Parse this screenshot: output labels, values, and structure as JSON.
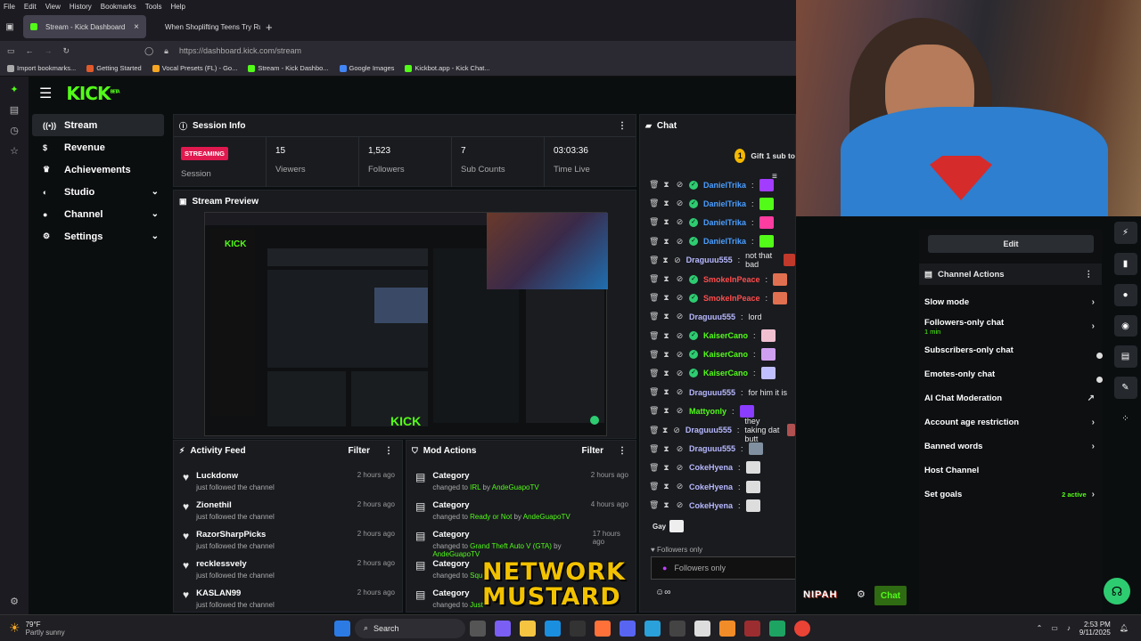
{
  "menu": [
    "File",
    "Edit",
    "View",
    "History",
    "Bookmarks",
    "Tools",
    "Help"
  ],
  "tabs": [
    {
      "label": "Stream - Kick Dashboard",
      "active": true
    },
    {
      "label": "When Shoplifting Teens Try Run",
      "active": false
    }
  ],
  "url": "https://dashboard.kick.com/stream",
  "bookmarks": [
    "Import bookmarks...",
    "Getting Started",
    "Vocal Presets (FL) - Go...",
    "Stream - Kick Dashbo...",
    "Google Images",
    "Kickbot.app - Kick Chat..."
  ],
  "app": {
    "logo": "KICK",
    "logo_sup": "BETA"
  },
  "nav": [
    {
      "label": "Stream",
      "icon": "stream-icon",
      "selected": true
    },
    {
      "label": "Revenue",
      "icon": "dollar-icon"
    },
    {
      "label": "Achievements",
      "icon": "trophy-icon"
    },
    {
      "label": "Studio",
      "icon": "studio-icon",
      "chevron": true
    },
    {
      "label": "Channel",
      "icon": "user-icon",
      "chevron": true
    },
    {
      "label": "Settings",
      "icon": "gear-icon",
      "chevron": true
    }
  ],
  "session": {
    "title": "Session Info",
    "status": "STREAMING",
    "status_label": "Session",
    "stats": [
      {
        "value": "15",
        "label": "Viewers"
      },
      {
        "value": "1,523",
        "label": "Followers"
      },
      {
        "value": "7",
        "label": "Sub Counts"
      },
      {
        "value": "03:03:36",
        "label": "Time Live"
      }
    ]
  },
  "preview": {
    "title": "Stream Preview"
  },
  "activity": {
    "title": "Activity Feed",
    "filter": "Filter",
    "items": [
      {
        "name": "Luckdonw",
        "sub": "just followed the channel",
        "time": "2 hours ago"
      },
      {
        "name": "Zionethil",
        "sub": "just followed the channel",
        "time": "2 hours ago"
      },
      {
        "name": "RazorSharpPicks",
        "sub": "just followed the channel",
        "time": "2 hours ago"
      },
      {
        "name": "recklessvely",
        "sub": "just followed the channel",
        "time": "2 hours ago"
      },
      {
        "name": "KASLAN99",
        "sub": "just followed the channel",
        "time": "2 hours ago"
      }
    ]
  },
  "mod": {
    "title": "Mod Actions",
    "filter": "Filter",
    "items": [
      {
        "name": "Category",
        "pre": "changed to ",
        "target": "IRL",
        "by": " by ",
        "user": "AndeGuapoTV",
        "time": "2 hours ago"
      },
      {
        "name": "Category",
        "pre": "changed to ",
        "target": "Ready or Not",
        "by": " by ",
        "user": "AndeGuapoTV",
        "time": "4 hours ago"
      },
      {
        "name": "Category",
        "pre": "changed to ",
        "target": "Grand Theft Auto V (GTA)",
        "by": " by ",
        "user": "AndeGuapoTV",
        "time": "17 hours ago"
      },
      {
        "name": "Category",
        "pre": "changed to ",
        "target": "Squ",
        "by": "",
        "user": "",
        "time": ""
      },
      {
        "name": "Category",
        "pre": "changed to ",
        "target": "Just",
        "by": "",
        "user": "",
        "time": ""
      }
    ]
  },
  "chat": {
    "title": "Chat",
    "gift": "Gift 1 sub to",
    "gift_count": "1",
    "messages": [
      {
        "user": "DanielTrika",
        "color": "#4a9eff",
        "verified": true,
        "text": "",
        "emote": "#a23cff"
      },
      {
        "user": "DanielTrika",
        "color": "#4a9eff",
        "verified": true,
        "text": "",
        "emote": "#53fc18"
      },
      {
        "user": "DanielTrika",
        "color": "#4a9eff",
        "verified": true,
        "text": "",
        "emote": "#ff3ca0"
      },
      {
        "user": "DanielTrika",
        "color": "#4a9eff",
        "verified": true,
        "text": "",
        "emote": "#53fc18"
      },
      {
        "user": "Draguuu555",
        "color": "#b8b8ff",
        "verified": false,
        "text": "not that bad",
        "emote": "#c0392b"
      },
      {
        "user": "SmokeInPeace",
        "color": "#ff4d4d",
        "verified": true,
        "text": "",
        "emote": "#e07050"
      },
      {
        "user": "SmokeInPeace",
        "color": "#ff4d4d",
        "verified": true,
        "text": "",
        "emote": "#e07050"
      },
      {
        "user": "Draguuu555",
        "color": "#b8b8ff",
        "verified": false,
        "text": "lord",
        "emote": ""
      },
      {
        "user": "KaiserCano",
        "color": "#53fc18",
        "verified": true,
        "text": "",
        "emote": "#f0c0d0"
      },
      {
        "user": "KaiserCano",
        "color": "#53fc18",
        "verified": true,
        "text": "",
        "emote": "#d0a0f0"
      },
      {
        "user": "KaiserCano",
        "color": "#53fc18",
        "verified": true,
        "text": "",
        "emote": "#c0c0ff"
      },
      {
        "user": "Draguuu555",
        "color": "#b8b8ff",
        "verified": false,
        "text": "for him it is",
        "emote": ""
      },
      {
        "user": "Mattyonly",
        "color": "#53fc18",
        "verified": false,
        "text": "",
        "emote": "#8a3cff"
      },
      {
        "user": "Draguuu555",
        "color": "#b8b8ff",
        "verified": false,
        "text": "they taking dat butt",
        "emote": "#b05050"
      },
      {
        "user": "Draguuu555",
        "color": "#b8b8ff",
        "verified": false,
        "text": "",
        "emote": "#8090a0"
      },
      {
        "user": "CokeHyena",
        "color": "#b8b8ff",
        "verified": false,
        "text": "",
        "emote": "#ddd"
      },
      {
        "user": "CokeHyena",
        "color": "#b8b8ff",
        "verified": false,
        "text": "",
        "emote": "#ddd"
      },
      {
        "user": "CokeHyena",
        "color": "#b8b8ff",
        "verified": false,
        "text": "",
        "emote": "#ddd"
      }
    ],
    "gay_label": "Gay",
    "followers_only": "Followers only",
    "input_placeholder": "Followers only",
    "send": "Chat",
    "brand": "NIPAH"
  },
  "channel_actions": {
    "edit": "Edit",
    "title": "Channel Actions",
    "items": [
      {
        "label": "Slow mode",
        "right": "chevron"
      },
      {
        "label": "Followers-only chat",
        "sub": "1 min",
        "right": "chevron"
      },
      {
        "label": "Subscribers-only chat",
        "right": "toggle"
      },
      {
        "label": "Emotes-only chat",
        "right": "toggle"
      },
      {
        "label": "AI Chat Moderation",
        "right": "external"
      },
      {
        "label": "Account age restriction",
        "right": "chevron"
      },
      {
        "label": "Banned words",
        "right": "chevron"
      },
      {
        "label": "Host Channel",
        "right": ""
      },
      {
        "label": "Set goals",
        "right": "chevron",
        "status": "2 active"
      }
    ]
  },
  "overlay": {
    "line1": "NETWORK",
    "line2": "MUSTARD"
  },
  "taskbar": {
    "temp": "79°F",
    "weather": "Partly sunny",
    "search": "Search",
    "time": "2:53 PM",
    "date": "9/11/2025"
  },
  "colors": {
    "accent": "#53fc18",
    "streaming": "#e0194f"
  }
}
